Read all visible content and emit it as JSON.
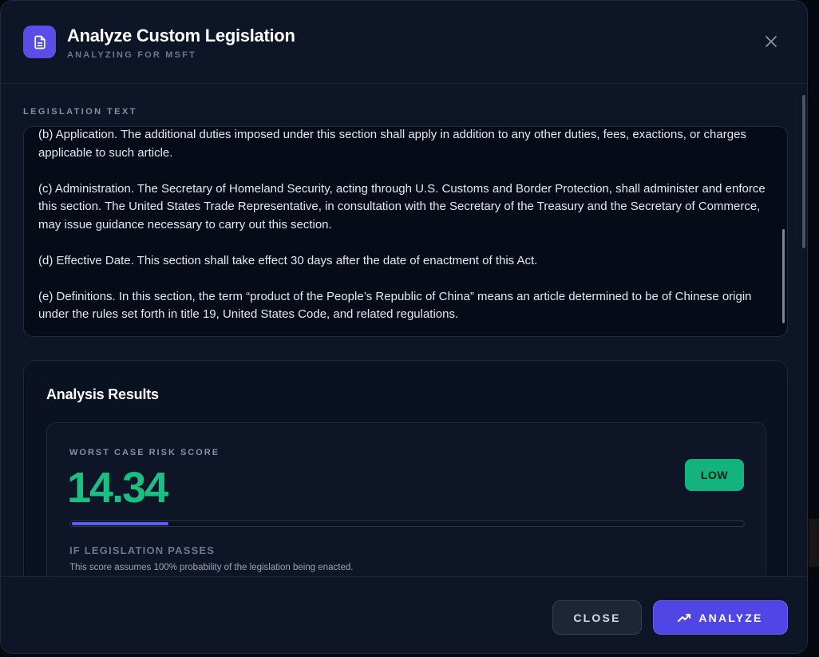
{
  "header": {
    "icon": "document-icon",
    "title": "Analyze Custom Legislation",
    "subtitle": "ANALYZING FOR MSFT",
    "close_icon": "close-icon"
  },
  "legislation": {
    "label": "LEGISLATION TEXT",
    "paragraphs": [
      "(b) Application. The additional duties imposed under this section shall apply in addition to any other duties, fees, exactions, or charges applicable to such article.",
      "(c) Administration. The Secretary of Homeland Security, acting through U.S. Customs and Border Protection, shall administer and enforce this section. The United States Trade Representative, in consultation with the Secretary of the Treasury and the Secretary of Commerce, may issue guidance necessary to carry out this section.",
      "(d) Effective Date. This section shall take effect 30 days after the date of enactment of this Act.",
      "(e) Definitions. In this section, the term “product of the People’s Republic of China” means an article determined to be of Chinese origin under the rules set forth in title 19, United States Code, and related regulations."
    ]
  },
  "results": {
    "title": "Analysis Results",
    "risk_label": "WORST CASE RISK SCORE",
    "risk_score": "14.34",
    "risk_fraction": 0.1434,
    "badge": "LOW",
    "passes_label": "IF LEGISLATION PASSES",
    "passes_note": "This score assumes 100% probability of the legislation being enacted."
  },
  "footer": {
    "close_label": "CLOSE",
    "analyze_label": "ANALYZE",
    "analyze_icon": "trending-up-icon"
  },
  "colors": {
    "accent": "#5b4de8",
    "risk_green": "#1bbf83",
    "badge_green": "#12b37c",
    "bar_fill": "#5b5ff0"
  }
}
